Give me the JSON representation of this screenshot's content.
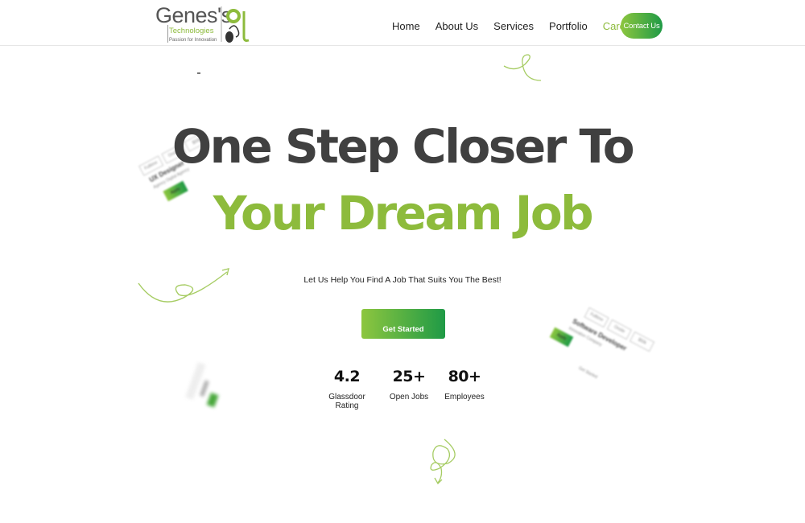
{
  "brand": {
    "name": "Genes's",
    "sub": "Technologies",
    "tagline": "Passion for Innovation",
    "accent": "#8dbb3c",
    "gradient_start": "#8dc63f",
    "gradient_end": "#1f9a46"
  },
  "nav": {
    "items": [
      {
        "label": "Home",
        "active": false
      },
      {
        "label": "About Us",
        "active": false
      },
      {
        "label": "Services",
        "active": false
      },
      {
        "label": "Portfolio",
        "active": false
      },
      {
        "label": "Career",
        "active": true
      }
    ],
    "contact_label": "Contact Us"
  },
  "hero": {
    "line1": "One Step Closer To",
    "line2": "Your Dream Job",
    "subtitle": "Let Us Help You Find A Job That Suits You The Best!",
    "cta_label": "Get Started"
  },
  "stats": [
    {
      "value": "4.2",
      "label": "Glassdoor Rating"
    },
    {
      "value": "25+",
      "label": "Open Jobs"
    },
    {
      "value": "80+",
      "label": "Employees"
    }
  ],
  "decor_cards": {
    "left": {
      "title": "UX Designer",
      "subtitle": "Agency Digital Agency",
      "chips": [
        "Fulltime",
        "Onsite",
        "$50k"
      ],
      "apply": "Apply"
    },
    "right": {
      "title": "Software Developer",
      "subtitle": "Innovation Company",
      "chips": [
        "Fulltime",
        "Onsite",
        "$50k"
      ],
      "apply": "Apply",
      "note": "Get Started"
    }
  }
}
